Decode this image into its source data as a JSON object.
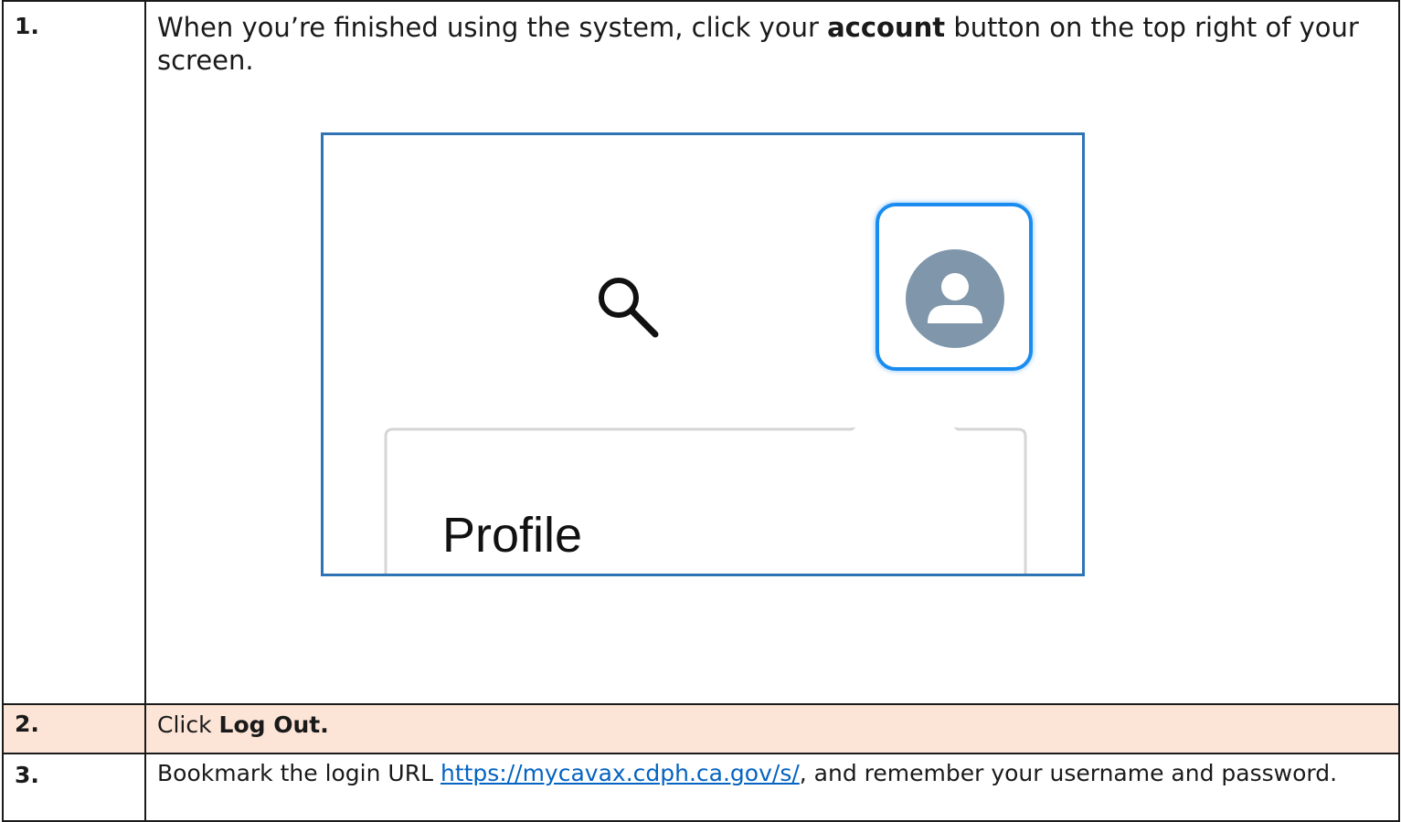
{
  "steps": [
    {
      "number": "1.",
      "text_before": "When you’re finished using the system, click your ",
      "text_bold": "account",
      "text_after": " button on the top right of your screen.",
      "screenshot": {
        "search_icon": "search-icon",
        "account_icon": "user-avatar-icon",
        "menu_item": "Profile",
        "accent_color": "#1a8cf0",
        "avatar_color": "#8097ab"
      }
    },
    {
      "number": "2.",
      "text_before": "Click ",
      "text_bold": "Log Out.",
      "background": "#fce4d6"
    },
    {
      "number": "3.",
      "text_before": "Bookmark the login URL ",
      "link": "https://mycavax.cdph.ca.gov/s/",
      "text_after": ", and remember your username and password."
    }
  ]
}
